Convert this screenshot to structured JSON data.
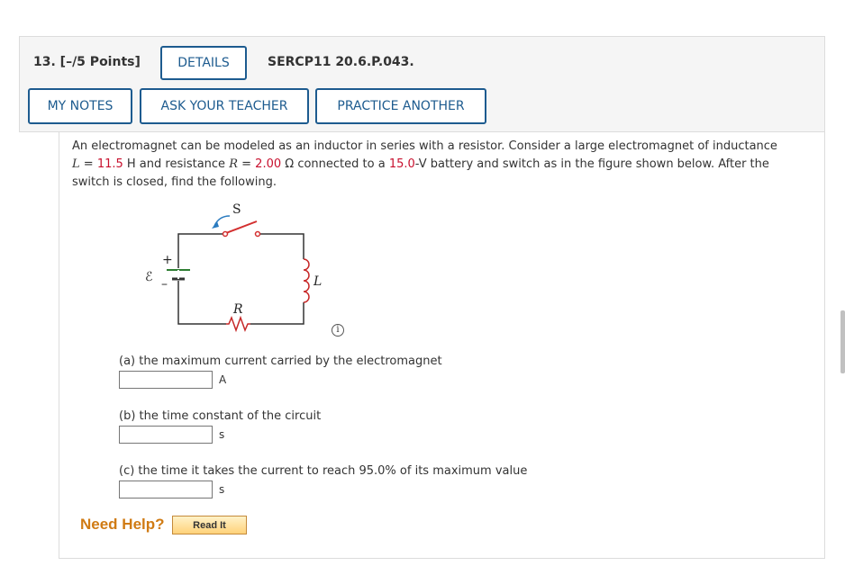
{
  "question": {
    "number_points": "13. [–/5 Points]",
    "details_label": "DETAILS",
    "code": "SERCP11 20.6.P.043."
  },
  "actions": {
    "my_notes": "MY NOTES",
    "ask_teacher": "ASK YOUR TEACHER",
    "practice_another": "PRACTICE ANOTHER"
  },
  "problem": {
    "intro": "An electromagnet can be modeled as an inductor in series with a resistor. Consider a large electromagnet of inductance",
    "L_symbol": "L",
    "eq1": " = ",
    "L_value": "11.5",
    "L_unit": " H and resistance ",
    "R_symbol": "R",
    "eq2": " = ",
    "R_value": "2.00",
    "R_unit": " Ω connected to a ",
    "V_value": "15.0",
    "V_unit": "-V battery and switch as in the figure shown below. After the",
    "outro": "switch is closed, find the following."
  },
  "figure": {
    "switch_label": "S",
    "emf_label": "ℰ",
    "plus": "+",
    "minus": "–",
    "resistor_label": "R",
    "inductor_label": "L",
    "info_icon": "i"
  },
  "parts": [
    {
      "label": "(a) the maximum current carried by the electromagnet",
      "unit": "A",
      "value": ""
    },
    {
      "label": "(b) the time constant of the circuit",
      "unit": "s",
      "value": ""
    },
    {
      "label": "(c) the time it takes the current to reach 95.0% of its maximum value",
      "unit": "s",
      "value": ""
    }
  ],
  "help": {
    "need_help": "Need Help?",
    "read_it": "Read It"
  },
  "colors": {
    "accent": "#1d5b8f",
    "given_value": "#c8102e",
    "help": "#d07b14"
  }
}
